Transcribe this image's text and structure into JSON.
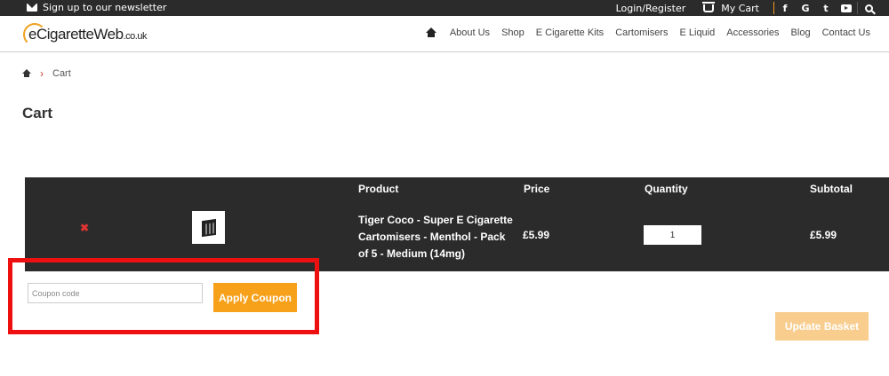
{
  "topbar": {
    "newsletter": "Sign up to our newsletter",
    "login": "Login/Register",
    "cart": "My Cart",
    "social": [
      "f",
      "G",
      "t"
    ]
  },
  "logo": {
    "main": "eCigaretteWeb",
    "tld": ".co.uk"
  },
  "nav": [
    "About Us",
    "Shop",
    "E Cigarette Kits",
    "Cartomisers",
    "E Liquid",
    "Accessories",
    "Blog",
    "Contact Us"
  ],
  "breadcrumb": {
    "current": "Cart"
  },
  "page": {
    "title": "Cart"
  },
  "table": {
    "headers": {
      "product": "Product",
      "price": "Price",
      "quantity": "Quantity",
      "subtotal": "Subtotal"
    },
    "rows": [
      {
        "remove": "✖",
        "product": "Tiger Coco - Super E Cigarette Cartomisers - Menthol - Pack of 5 - Medium (14mg)",
        "price": "£5.99",
        "quantity": "1",
        "subtotal": "£5.99"
      }
    ]
  },
  "coupon": {
    "placeholder": "Coupon code",
    "apply_label": "Apply Coupon"
  },
  "update_label": "Update Basket",
  "colors": {
    "accent": "#f7a019",
    "dark": "#2b2b2b",
    "highlight": "#ee1010"
  }
}
